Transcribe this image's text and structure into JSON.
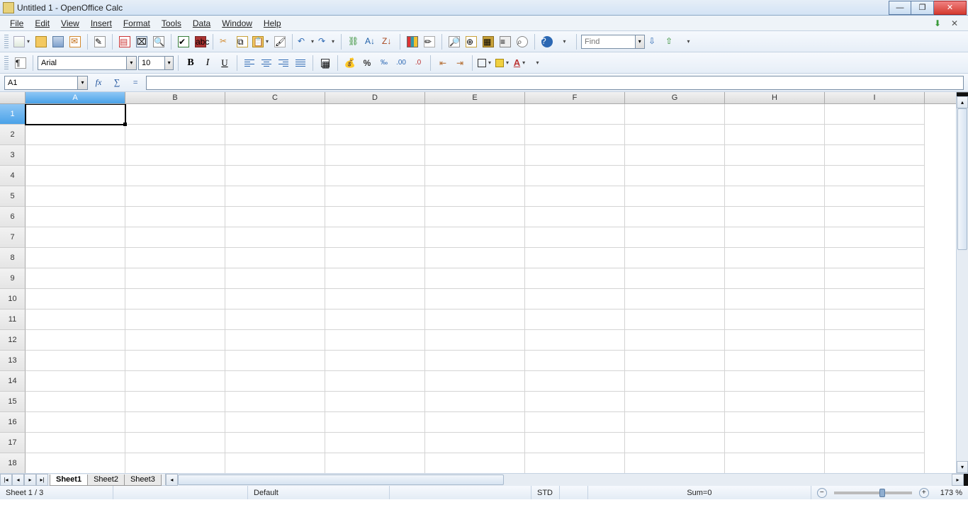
{
  "titlebar": {
    "title": "Untitled 1 - OpenOffice Calc"
  },
  "menu": {
    "file": "File",
    "edit": "Edit",
    "view": "View",
    "insert": "Insert",
    "format": "Format",
    "tools": "Tools",
    "data": "Data",
    "window": "Window",
    "help": "Help"
  },
  "font": {
    "name": "Arial",
    "size": "10"
  },
  "format_labels": {
    "bold": "B",
    "italic": "I",
    "underline": "U",
    "percent": "%",
    "fontcolor": "A"
  },
  "find": {
    "placeholder": "Find"
  },
  "namebox": {
    "value": "A1"
  },
  "formula": {
    "fx": "fx",
    "sigma": "∑",
    "eq": "="
  },
  "columns": [
    "A",
    "B",
    "C",
    "D",
    "E",
    "F",
    "G",
    "H",
    "I"
  ],
  "rows": [
    "1",
    "2",
    "3",
    "4",
    "5",
    "6",
    "7",
    "8",
    "9",
    "10",
    "11",
    "12",
    "13",
    "14",
    "15",
    "16",
    "17",
    "18"
  ],
  "selected": {
    "col": 0,
    "row": 0
  },
  "tabs": {
    "s1": "Sheet1",
    "s2": "Sheet2",
    "s3": "Sheet3"
  },
  "status": {
    "sheet": "Sheet 1 / 3",
    "style": "Default",
    "mode": "STD",
    "sum": "Sum=0",
    "zoom": "173 %"
  },
  "help_glyph": "?"
}
